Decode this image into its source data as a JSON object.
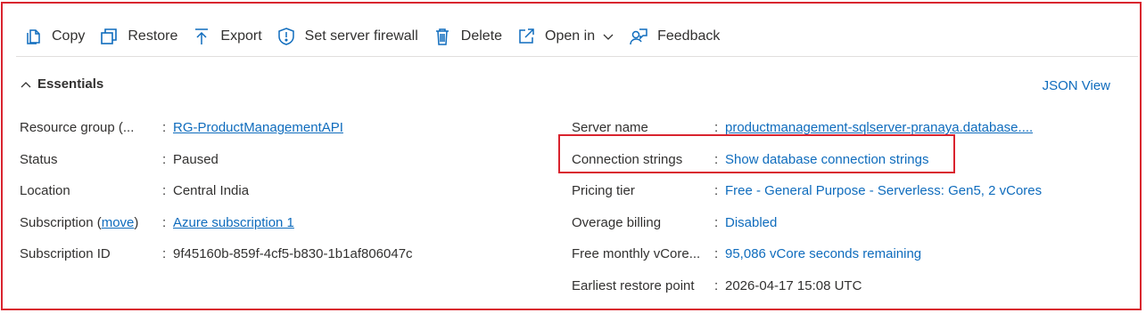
{
  "toolbar": {
    "copy": "Copy",
    "restore": "Restore",
    "export": "Export",
    "firewall": "Set server firewall",
    "delete": "Delete",
    "open_in": "Open in",
    "feedback": "Feedback"
  },
  "essentials": {
    "title": "Essentials",
    "json_view": "JSON View"
  },
  "left": {
    "resource_group_label": "Resource group (...",
    "resource_group_value": "RG-ProductManagementAPI",
    "status_label": "Status",
    "status_value": "Paused",
    "location_label": "Location",
    "location_value": "Central India",
    "subscription_label_prefix": "Subscription (",
    "subscription_move": "move",
    "subscription_label_suffix": ")",
    "subscription_value": "Azure subscription 1",
    "subscription_id_label": "Subscription ID",
    "subscription_id_value": "9f45160b-859f-4cf5-b830-1b1af806047c"
  },
  "right": {
    "server_name_label": "Server name",
    "server_name_value": "productmanagement-sqlserver-pranaya.database....",
    "conn_label": "Connection strings",
    "conn_value": "Show database connection strings",
    "pricing_label": "Pricing tier",
    "pricing_value": "Free - General Purpose - Serverless: Gen5, 2 vCores",
    "overage_label": "Overage billing",
    "overage_value": "Disabled",
    "vcore_label": "Free monthly vCore...",
    "vcore_value": "95,086 vCore seconds remaining",
    "restore_label": "Earliest restore point",
    "restore_value": "2026-04-17 15:08 UTC"
  },
  "separator": ":",
  "colors": {
    "link": "#0f6cbd",
    "highlight": "#d9232e",
    "icon": "#0f6cbd"
  }
}
